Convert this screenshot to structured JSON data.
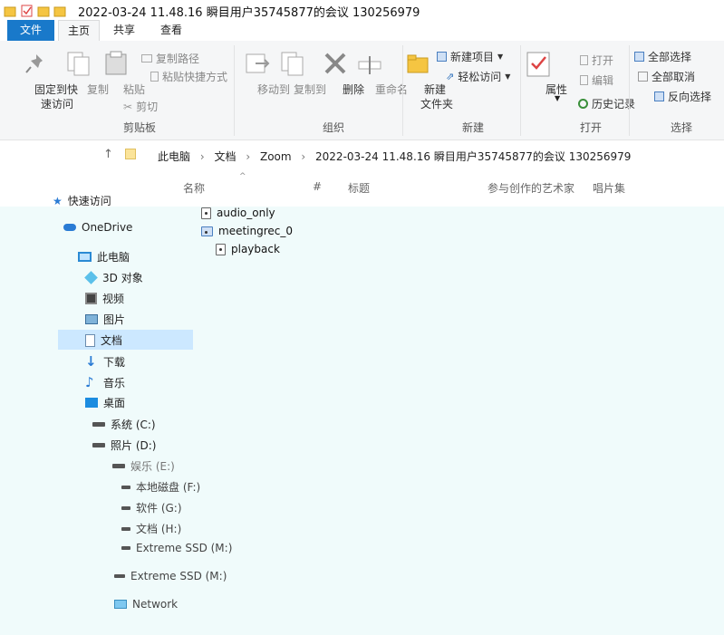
{
  "window": {
    "title": "2022-03-24 11.48.16 瞬目用户35745877的会议 130256979"
  },
  "tabs": [
    "文件",
    "主页",
    "共享",
    "查看"
  ],
  "ribbon": {
    "pin": "固定到快",
    "pin2": "速访问",
    "copy": "复制",
    "paste": "粘贴",
    "copy_path": "复制路径",
    "paste_shortcut": "粘贴快捷方式",
    "cut": "剪切",
    "move_to": "移动到",
    "copy_to": "复制到",
    "delete": "删除",
    "rename": "重命名",
    "new_folder": "新建",
    "new_folder2": "文件夹",
    "new_item": "新建项目",
    "easy_access": "轻松访问",
    "properties": "属性",
    "open": "打开",
    "edit": "编辑",
    "history": "历史记录",
    "select_all": "全部选择",
    "select_none": "全部取消",
    "invert_selection": "反向选择",
    "groups": {
      "clipboard": "剪贴板",
      "organize": "组织",
      "new": "新建",
      "open": "打开",
      "select": "选择"
    }
  },
  "breadcrumb": [
    "此电脑",
    "文档",
    "Zoom",
    "2022-03-24 11.48.16 瞬目用户35745877的会议 130256979"
  ],
  "columns": {
    "name": "名称",
    "number": "#",
    "title": "标题",
    "artist": "参与创作的艺术家",
    "album": "唱片集"
  },
  "nav": {
    "quick_access": "快速访问",
    "onedrive": "OneDrive",
    "this_pc": "此电脑",
    "objects3d": "3D 对象",
    "videos": "视频",
    "pictures": "图片",
    "documents": "文档",
    "downloads": "下载",
    "music": "音乐",
    "desktop": "桌面",
    "drive_c": "系统 (C:)",
    "drive_d": "照片 (D:)",
    "drive_e": "娱乐 (E:)",
    "drive_f": "本地磁盘 (F:)",
    "drive_g": "软件 (G:)",
    "drive_h": "文档 (H:)",
    "drive_m": "Extreme SSD (M:)",
    "drive_m2": "Extreme SSD (M:)",
    "network": "Network"
  },
  "files": [
    "audio_only",
    "meetingrec_0",
    "playback"
  ],
  "colors": {
    "accent": "#1979ca",
    "nav_bg": "#f0fbfb",
    "selected": "#cce8ff"
  }
}
